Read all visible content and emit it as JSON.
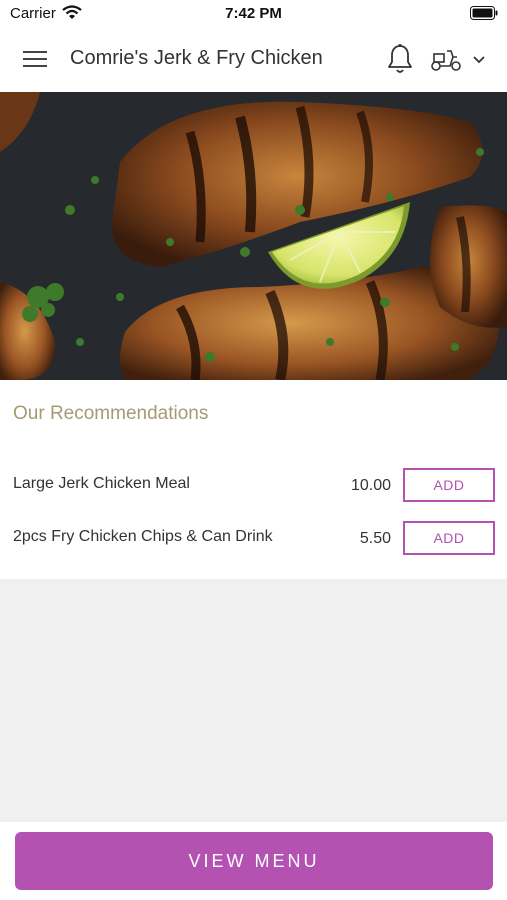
{
  "status_bar": {
    "carrier": "Carrier",
    "time": "7:42 PM"
  },
  "header": {
    "title": "Comrie's Jerk & Fry Chicken"
  },
  "icons": {
    "menu": "hamburger-menu-icon",
    "notifications": "bell-icon",
    "delivery": "scooter-delivery-icon",
    "dropdown": "chevron-down-icon"
  },
  "hero": {
    "image": "grilled-jerk-chicken-drumsticks-with-lime"
  },
  "recommendations": {
    "title": "Our Recommendations",
    "items": [
      {
        "name": "Large Jerk Chicken Meal",
        "price": "10.00",
        "button": "ADD"
      },
      {
        "name": "2pcs Fry Chicken Chips & Can Drink",
        "price": "5.50",
        "button": "ADD"
      }
    ]
  },
  "footer": {
    "button": "VIEW MENU"
  },
  "colors": {
    "accent": "#b352b1",
    "section_title": "#a59a74",
    "background": "#f0f0f0"
  }
}
